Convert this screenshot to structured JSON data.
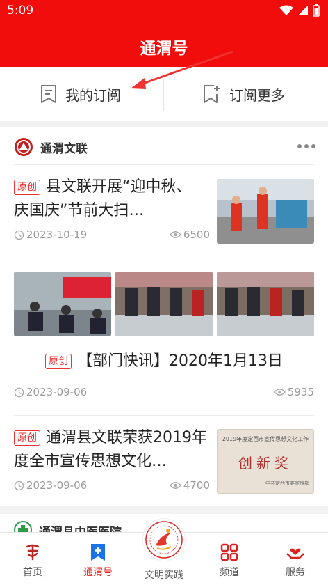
{
  "status": {
    "time": "5:09"
  },
  "header": {
    "title": "通渭号"
  },
  "subnav": {
    "my_subs": "我的订阅",
    "more_subs": "订阅更多"
  },
  "channels": [
    {
      "name": "通渭文联"
    },
    {
      "name": "通渭县中医医院"
    }
  ],
  "badge_label": "原创",
  "articles": [
    {
      "title": "县文联开展“迎中秋、庆国庆”节前大扫…",
      "date": "2023-10-19",
      "views": "6500"
    },
    {
      "title": "【部门快讯】2020年1月13日",
      "date": "2023-09-06",
      "views": "5935"
    },
    {
      "title": "通渭县文联荣获2019年度全市宣传思想文化…",
      "date": "2023-09-06",
      "views": "4700",
      "thumb_text": {
        "line1": "2019年度定西市宣传思想文化工作",
        "line2": "创新奖",
        "line3": "中共定西市委宣传部"
      }
    }
  ],
  "tabbar": {
    "items": [
      {
        "label": "首页"
      },
      {
        "label": "通渭号"
      },
      {
        "label": "文明实践"
      },
      {
        "label": "频道"
      },
      {
        "label": "服务"
      }
    ]
  },
  "colors": {
    "brand_red": "#f20d0d",
    "accent_blue": "#1a73e8"
  }
}
